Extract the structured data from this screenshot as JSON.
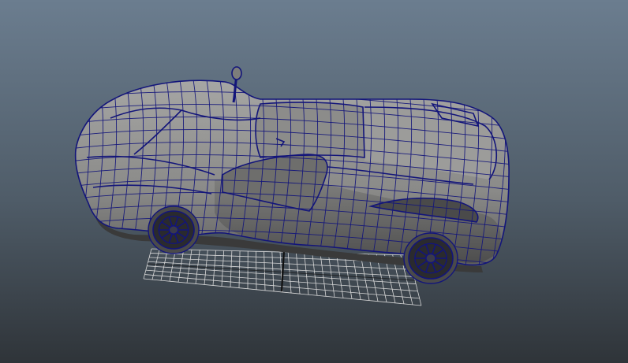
{
  "viewport": {
    "background_top": "#6b7d8f",
    "background_mid": "#4f5c68",
    "background_bottom": "#2f3439",
    "wire_color": "#13157a",
    "body_light": "#9a9a98",
    "body_shadow": "#5a5a5a",
    "grid_color": "#d8d8d8",
    "grid_axis_color": "#111111"
  },
  "scene": {
    "object": "sports-car-wireframe-model",
    "grid": "ground-grid"
  }
}
